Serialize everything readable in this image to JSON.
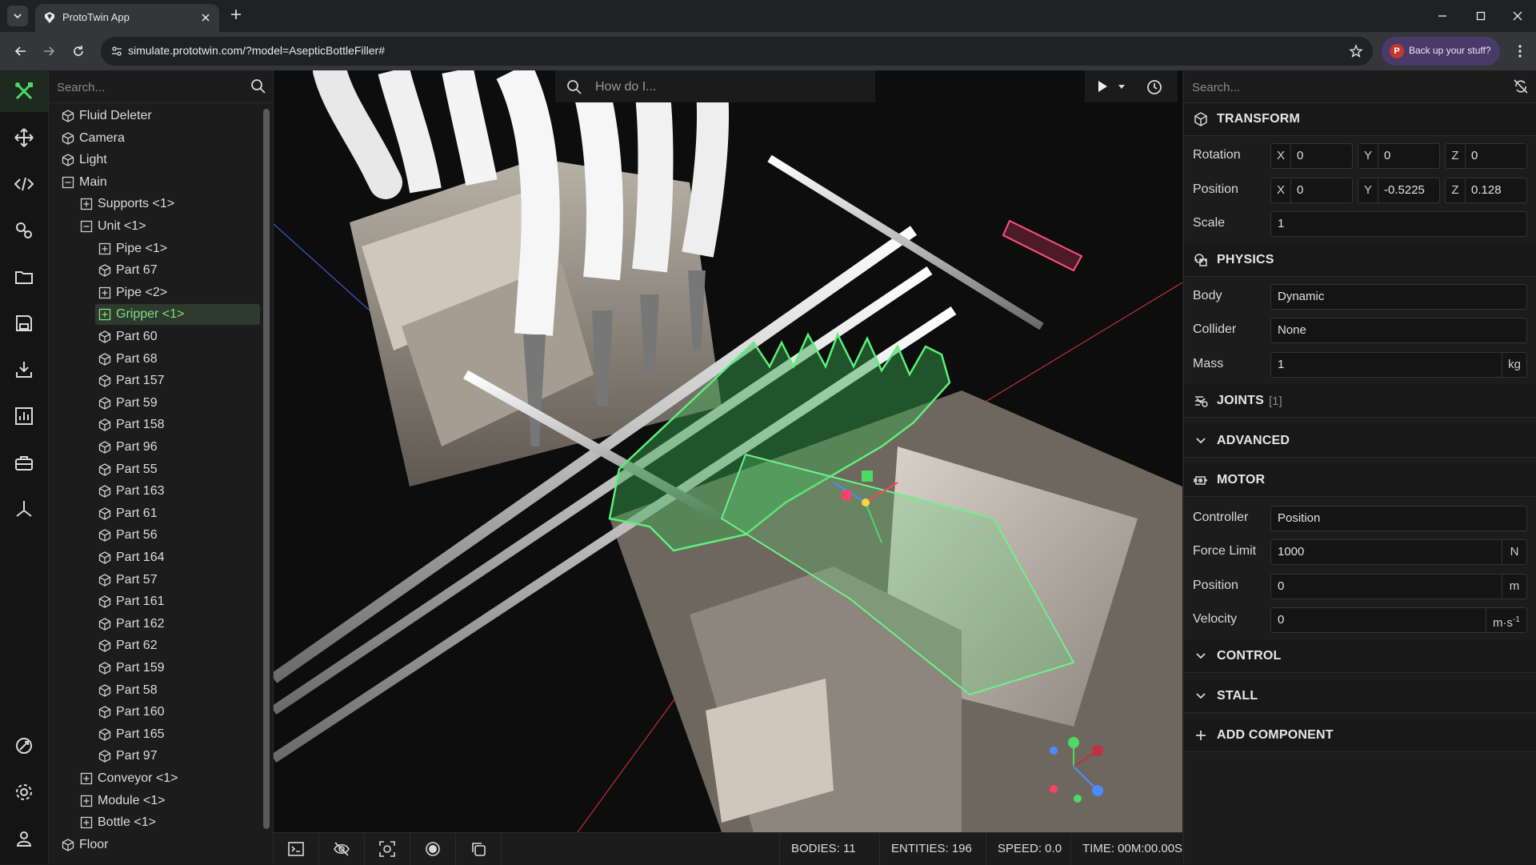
{
  "browser": {
    "tab_title": "ProtoTwin App",
    "url": "simulate.prototwin.com/?model=AsepticBottleFiller#",
    "profile_initial": "P",
    "profile_label": "Back up your stuff?"
  },
  "tree": {
    "search_placeholder": "Search...",
    "items": [
      {
        "label": "Fluid Deleter",
        "kind": "cube"
      },
      {
        "label": "Camera",
        "kind": "cube"
      },
      {
        "label": "Light",
        "kind": "cube"
      },
      {
        "label": "Main",
        "kind": "minus"
      },
      {
        "label": "Supports <1>",
        "kind": "plus"
      },
      {
        "label": "Unit <1>",
        "kind": "minus"
      },
      {
        "label": "Pipe <1>",
        "kind": "plus"
      },
      {
        "label": "Part 67",
        "kind": "cube"
      },
      {
        "label": "Pipe <2>",
        "kind": "plus"
      },
      {
        "label": "Gripper <1>",
        "kind": "plus"
      },
      {
        "label": "Part 60",
        "kind": "cube"
      },
      {
        "label": "Part 68",
        "kind": "cube"
      },
      {
        "label": "Part 157",
        "kind": "cube"
      },
      {
        "label": "Part 59",
        "kind": "cube"
      },
      {
        "label": "Part 158",
        "kind": "cube"
      },
      {
        "label": "Part 96",
        "kind": "cube"
      },
      {
        "label": "Part 55",
        "kind": "cube"
      },
      {
        "label": "Part 163",
        "kind": "cube"
      },
      {
        "label": "Part 61",
        "kind": "cube"
      },
      {
        "label": "Part 56",
        "kind": "cube"
      },
      {
        "label": "Part 164",
        "kind": "cube"
      },
      {
        "label": "Part 57",
        "kind": "cube"
      },
      {
        "label": "Part 161",
        "kind": "cube"
      },
      {
        "label": "Part 162",
        "kind": "cube"
      },
      {
        "label": "Part 62",
        "kind": "cube"
      },
      {
        "label": "Part 159",
        "kind": "cube"
      },
      {
        "label": "Part 58",
        "kind": "cube"
      },
      {
        "label": "Part 160",
        "kind": "cube"
      },
      {
        "label": "Part 165",
        "kind": "cube"
      },
      {
        "label": "Part 97",
        "kind": "cube"
      },
      {
        "label": "Conveyor <1>",
        "kind": "plus"
      },
      {
        "label": "Module <1>",
        "kind": "plus"
      },
      {
        "label": "Bottle <1>",
        "kind": "plus"
      },
      {
        "label": "Floor",
        "kind": "cube"
      }
    ],
    "selected_label": "Gripper <1>"
  },
  "viewport": {
    "help_placeholder": "How do I..."
  },
  "status": {
    "bodies": "BODIES: 11",
    "entities": "ENTITIES: 196",
    "speed": "SPEED: 0.0",
    "time": "TIME: 00M:00.00S"
  },
  "inspector": {
    "search_placeholder": "Search...",
    "transform": {
      "title": "TRANSFORM",
      "rotation_label": "Rotation",
      "position_label": "Position",
      "scale_label": "Scale",
      "axis_x": "X",
      "axis_y": "Y",
      "axis_z": "Z",
      "rotation": {
        "x": "0",
        "y": "0",
        "z": "0"
      },
      "position": {
        "x": "0",
        "y": "-0.5225",
        "z": "0.128"
      },
      "scale": "1"
    },
    "physics": {
      "title": "PHYSICS",
      "body_label": "Body",
      "body": "Dynamic",
      "collider_label": "Collider",
      "collider": "None",
      "mass_label": "Mass",
      "mass": "1",
      "mass_unit": "kg"
    },
    "joints": {
      "title": "JOINTS",
      "count": "[1]"
    },
    "advanced": {
      "title": "ADVANCED"
    },
    "motor": {
      "title": "MOTOR",
      "controller_label": "Controller",
      "controller": "Position",
      "force_label": "Force Limit",
      "force": "1000",
      "force_unit": "N",
      "position_label": "Position",
      "position": "0",
      "position_unit": "m",
      "velocity_label": "Velocity",
      "velocity": "0",
      "velocity_unit": "m·s",
      "velocity_unit_exp": "-1"
    },
    "control": {
      "title": "CONTROL"
    },
    "stall": {
      "title": "STALL"
    },
    "add_component": "ADD COMPONENT"
  },
  "colors": {
    "accent": "#4cd964",
    "selection": "#7ee07e",
    "background": "#1c1c1c"
  }
}
